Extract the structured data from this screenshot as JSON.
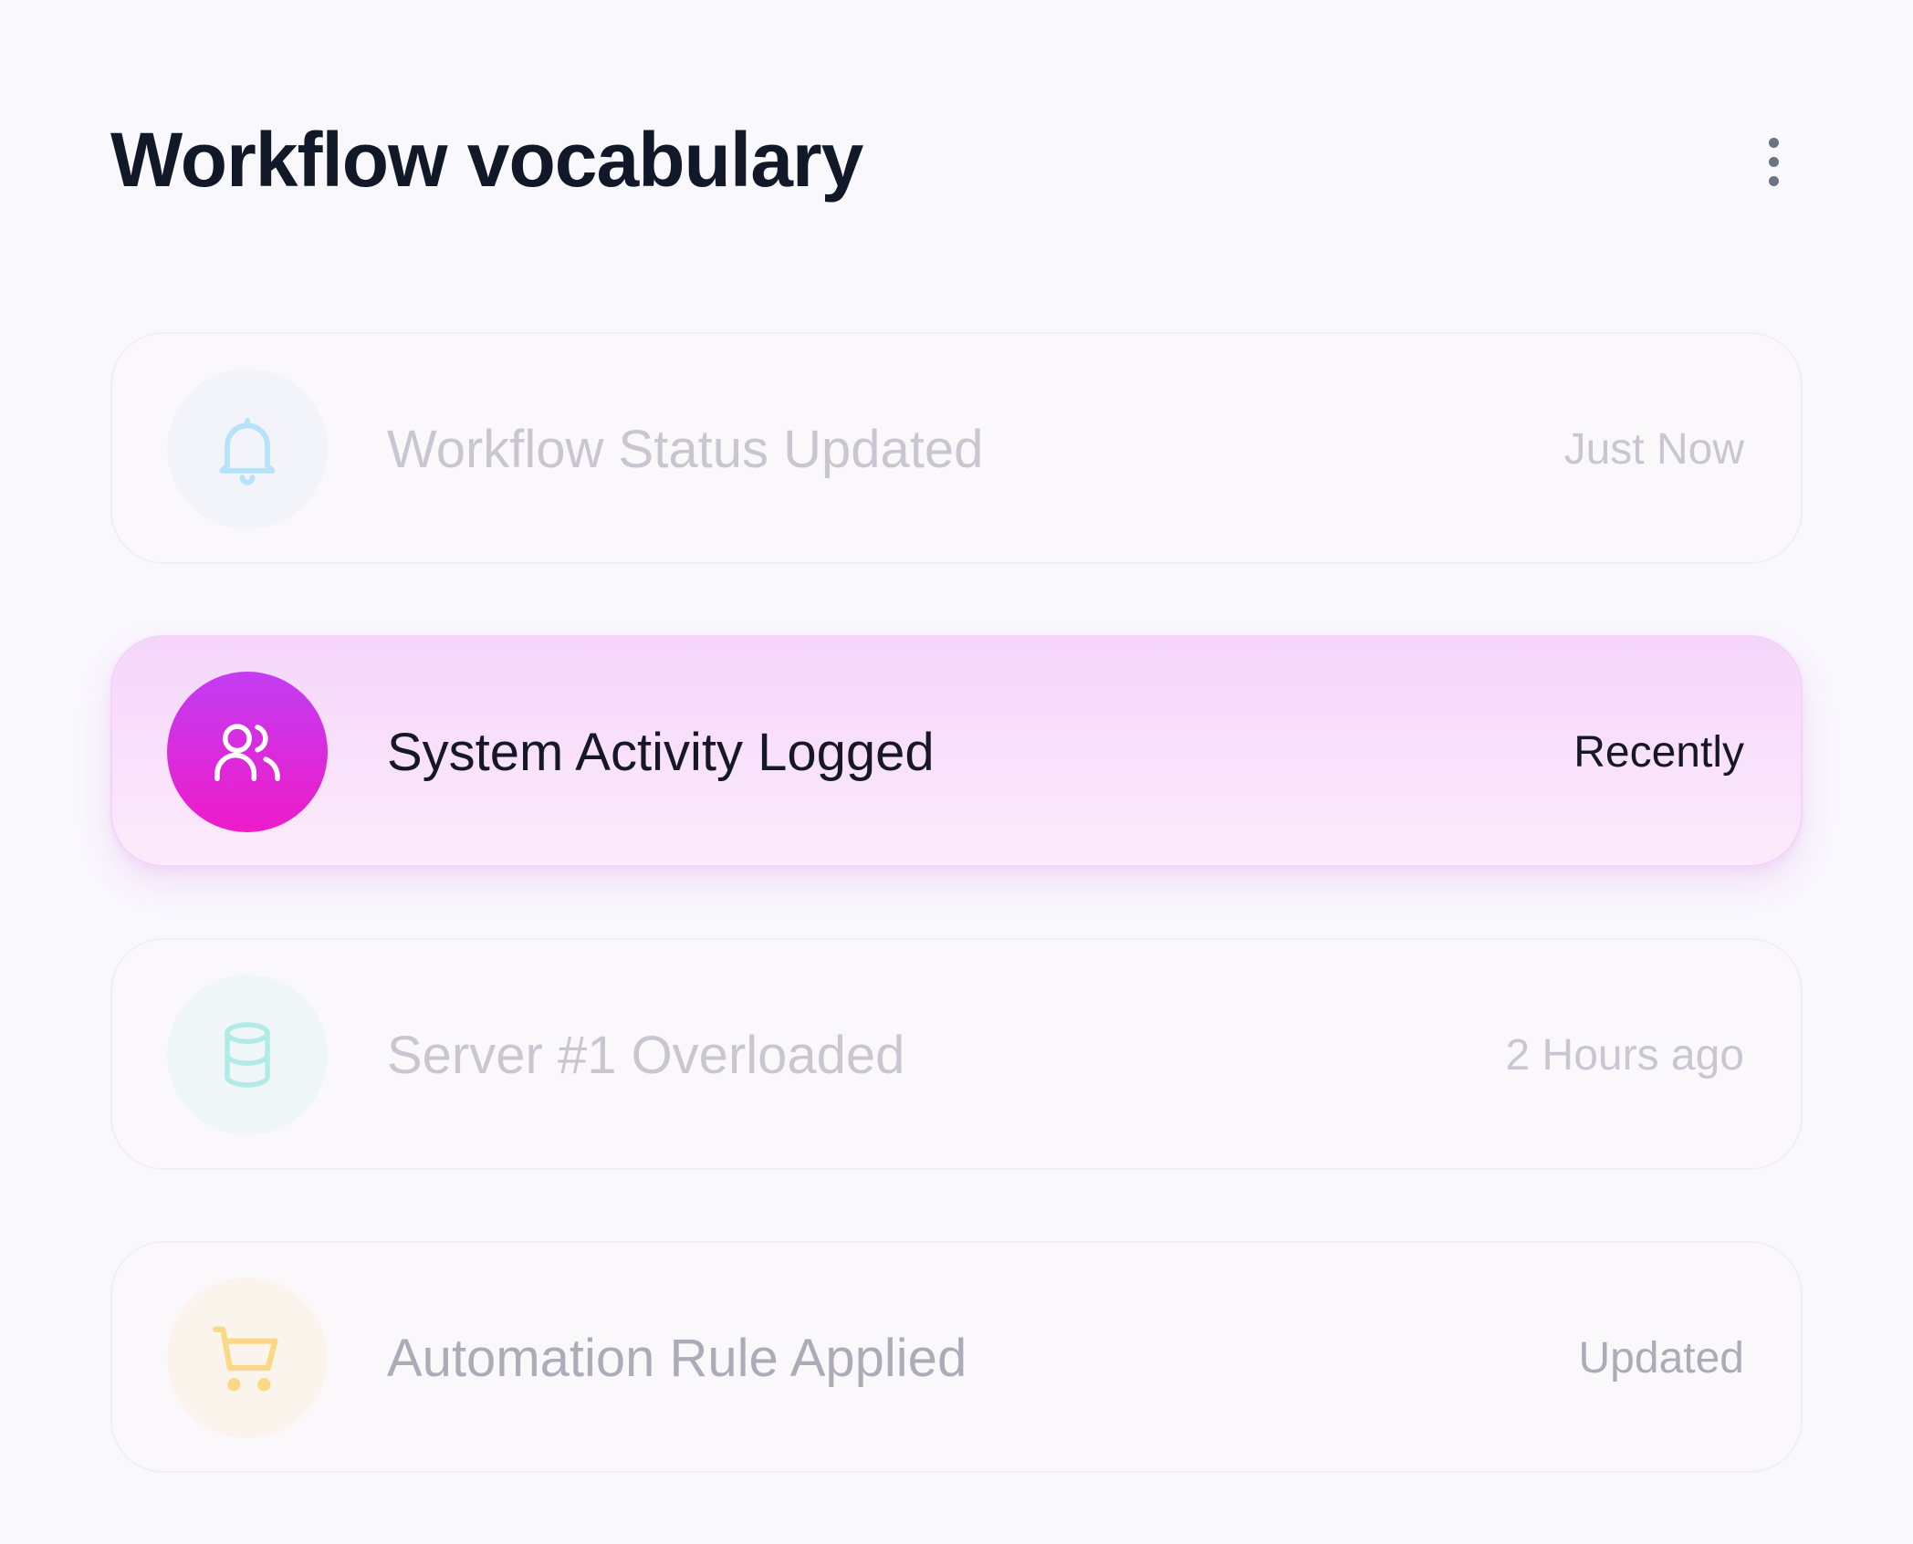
{
  "header": {
    "title": "Workflow vocabulary",
    "menu_icon": "more-vertical-icon"
  },
  "items": [
    {
      "title": "Workflow Status Updated",
      "time": "Just Now",
      "icon": "bell-icon",
      "icon_color": "#38bdf8",
      "state": "dimmed"
    },
    {
      "title": "System Activity Logged",
      "time": "Recently",
      "icon": "users-icon",
      "icon_color": "#ffffff",
      "accent_from": "#c23cf2",
      "accent_to": "#ef1bc9",
      "state": "active"
    },
    {
      "title": "Server #1 Overloaded",
      "time": "2 Hours ago",
      "icon": "database-icon",
      "icon_color": "#2dd4bf",
      "state": "dimmed"
    },
    {
      "title": "Automation Rule Applied",
      "time": "Updated",
      "icon": "shopping-cart-icon",
      "icon_color": "#fbbf24",
      "state": "dimmed"
    }
  ]
}
